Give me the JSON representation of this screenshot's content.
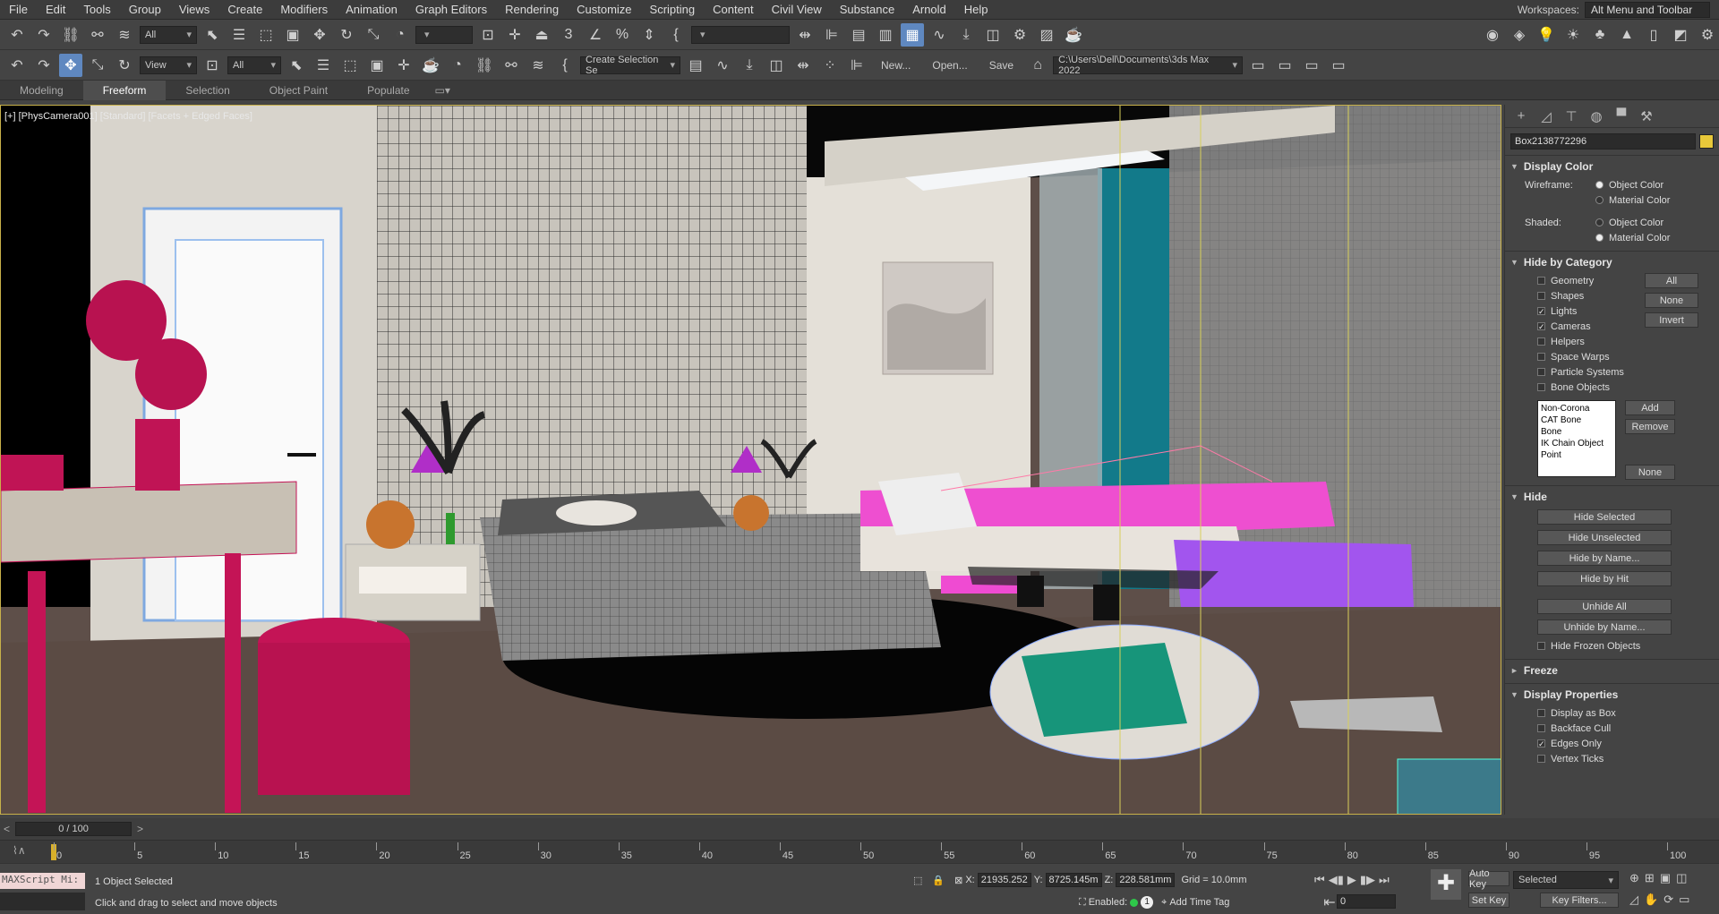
{
  "menu": [
    "File",
    "Edit",
    "Tools",
    "Group",
    "Views",
    "Create",
    "Modifiers",
    "Animation",
    "Graph Editors",
    "Rendering",
    "Customize",
    "Scripting",
    "Content",
    "Civil View",
    "Substance",
    "Arnold",
    "Help"
  ],
  "workspace": {
    "label": "Workspaces:",
    "value": "Alt Menu and Toolbar"
  },
  "toolbar1": {
    "selection_filter": "All"
  },
  "toolbar2": {
    "ref_coord": "View",
    "selection_filter": "All",
    "named_selection": "Create Selection Se",
    "new_label": "New...",
    "open_label": "Open...",
    "save_label": "Save",
    "project_path": "C:\\Users\\Dell\\Documents\\3ds Max 2022"
  },
  "ribbon_tabs": [
    {
      "label": "Modeling",
      "active": false
    },
    {
      "label": "Freeform",
      "active": true
    },
    {
      "label": "Selection",
      "active": false
    },
    {
      "label": "Object Paint",
      "active": false
    },
    {
      "label": "Populate",
      "active": false
    }
  ],
  "viewport": {
    "label": "[+] [PhysCamera001] [Standard] [Facets + Edged Faces]"
  },
  "command_panel": {
    "object_name": "Box2138772296",
    "object_color": "#e8c83a",
    "display_color": {
      "title": "Display Color",
      "wireframe_label": "Wireframe:",
      "shaded_label": "Shaded:",
      "object_color": "Object Color",
      "material_color": "Material Color"
    },
    "hide_by_category": {
      "title": "Hide by Category",
      "items": [
        {
          "label": "Geometry",
          "checked": false
        },
        {
          "label": "Shapes",
          "checked": false
        },
        {
          "label": "Lights",
          "checked": true
        },
        {
          "label": "Cameras",
          "checked": true
        },
        {
          "label": "Helpers",
          "checked": false
        },
        {
          "label": "Space Warps",
          "checked": false
        },
        {
          "label": "Particle Systems",
          "checked": false
        },
        {
          "label": "Bone Objects",
          "checked": false
        }
      ],
      "all": "All",
      "none": "None",
      "invert": "Invert",
      "list": [
        "Non-Corona",
        "CAT Bone",
        "Bone",
        "IK Chain Object",
        "Point"
      ],
      "add": "Add",
      "remove": "Remove",
      "none2": "None"
    },
    "hide": {
      "title": "Hide",
      "buttons": [
        "Hide Selected",
        "Hide Unselected",
        "Hide by Name...",
        "Hide by Hit"
      ],
      "unhide_buttons": [
        "Unhide All",
        "Unhide by Name..."
      ],
      "hide_frozen": "Hide Frozen Objects"
    },
    "freeze": {
      "title": "Freeze"
    },
    "display_properties": {
      "title": "Display Properties",
      "items": [
        {
          "label": "Display as Box",
          "checked": false
        },
        {
          "label": "Backface Cull",
          "checked": false
        },
        {
          "label": "Edges Only",
          "checked": true
        },
        {
          "label": "Vertex Ticks",
          "checked": false
        }
      ]
    }
  },
  "time_slider": {
    "value": "0 / 100"
  },
  "trackbar": {
    "ticks": [
      "0",
      "5",
      "10",
      "15",
      "20",
      "25",
      "30",
      "35",
      "40",
      "45",
      "50",
      "55",
      "60",
      "65",
      "70",
      "75",
      "80",
      "85",
      "90",
      "95",
      "100"
    ]
  },
  "status": {
    "maxscript": "MAXScript Mi:",
    "selected": "1 Object Selected",
    "prompt": "Click and drag to select and move objects",
    "x_label": "X:",
    "x": "21935.252",
    "y_label": "Y:",
    "y": "8725.145m",
    "z_label": "Z:",
    "z": "228.581mm",
    "grid": "Grid = 10.0mm",
    "enabled_label": "Enabled:",
    "add_time_tag": "Add Time Tag",
    "auto_key": "Auto Key",
    "set_key": "Set Key",
    "key_mode": "Selected",
    "key_filters": "Key Filters...",
    "frame": "0",
    "badge": "1"
  }
}
